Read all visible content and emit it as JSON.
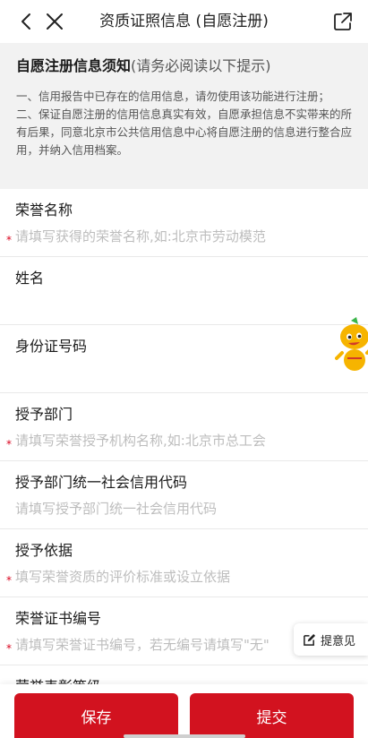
{
  "header": {
    "title": "资质证照信息 (自愿注册)",
    "back_icon": "chevron-left-icon",
    "close_icon": "close-icon",
    "share_icon": "external-link-icon"
  },
  "notice": {
    "title": "自愿注册信息须知",
    "hint": "(请务必阅读以下提示)",
    "line1": "一、信用报告中已存在的信用信息，请勿使用该功能进行注册；",
    "line2": "二、保证自愿注册的信用信息真实有效，自愿承担信息不实带来的所有后果，同意北京市公共信用信息中心将自愿注册的信息进行整合应用，并纳入信用档案。"
  },
  "form": {
    "required_mark": "*",
    "fields": [
      {
        "label": "荣誉名称",
        "placeholder": "请填写获得的荣誉名称,如:北京市劳动模范",
        "value": "",
        "required": true
      },
      {
        "label": "姓名",
        "placeholder": "",
        "value": "",
        "required": false
      },
      {
        "label": "身份证号码",
        "placeholder": "",
        "value": "",
        "required": false
      },
      {
        "label": "授予部门",
        "placeholder": "请填写荣誉授予机构名称,如:北京市总工会",
        "value": "",
        "required": true
      },
      {
        "label": "授予部门统一社会信用代码",
        "placeholder": "请填写授予部门统一社会信用代码",
        "value": "",
        "required": false
      },
      {
        "label": "授予依据",
        "placeholder": "填写荣誉资质的评价标准或设立依据",
        "value": "",
        "required": true
      },
      {
        "label": "荣誉证书编号",
        "placeholder": "请填写荣誉证书编号，若无编号请填写\"无\"",
        "value": "",
        "required": true
      },
      {
        "label": "荣誉表彰等级",
        "placeholder": "",
        "value": "",
        "required": false
      }
    ]
  },
  "floating": {
    "feedback_label": "提意见",
    "feedback_icon": "edit-icon",
    "mascot_icon": "mascot-icon"
  },
  "actions": {
    "save_label": "保存",
    "submit_label": "提交"
  },
  "colors": {
    "brand": "#d2121f",
    "required": "#d9001b",
    "notice_bg": "#f2f2f2"
  }
}
